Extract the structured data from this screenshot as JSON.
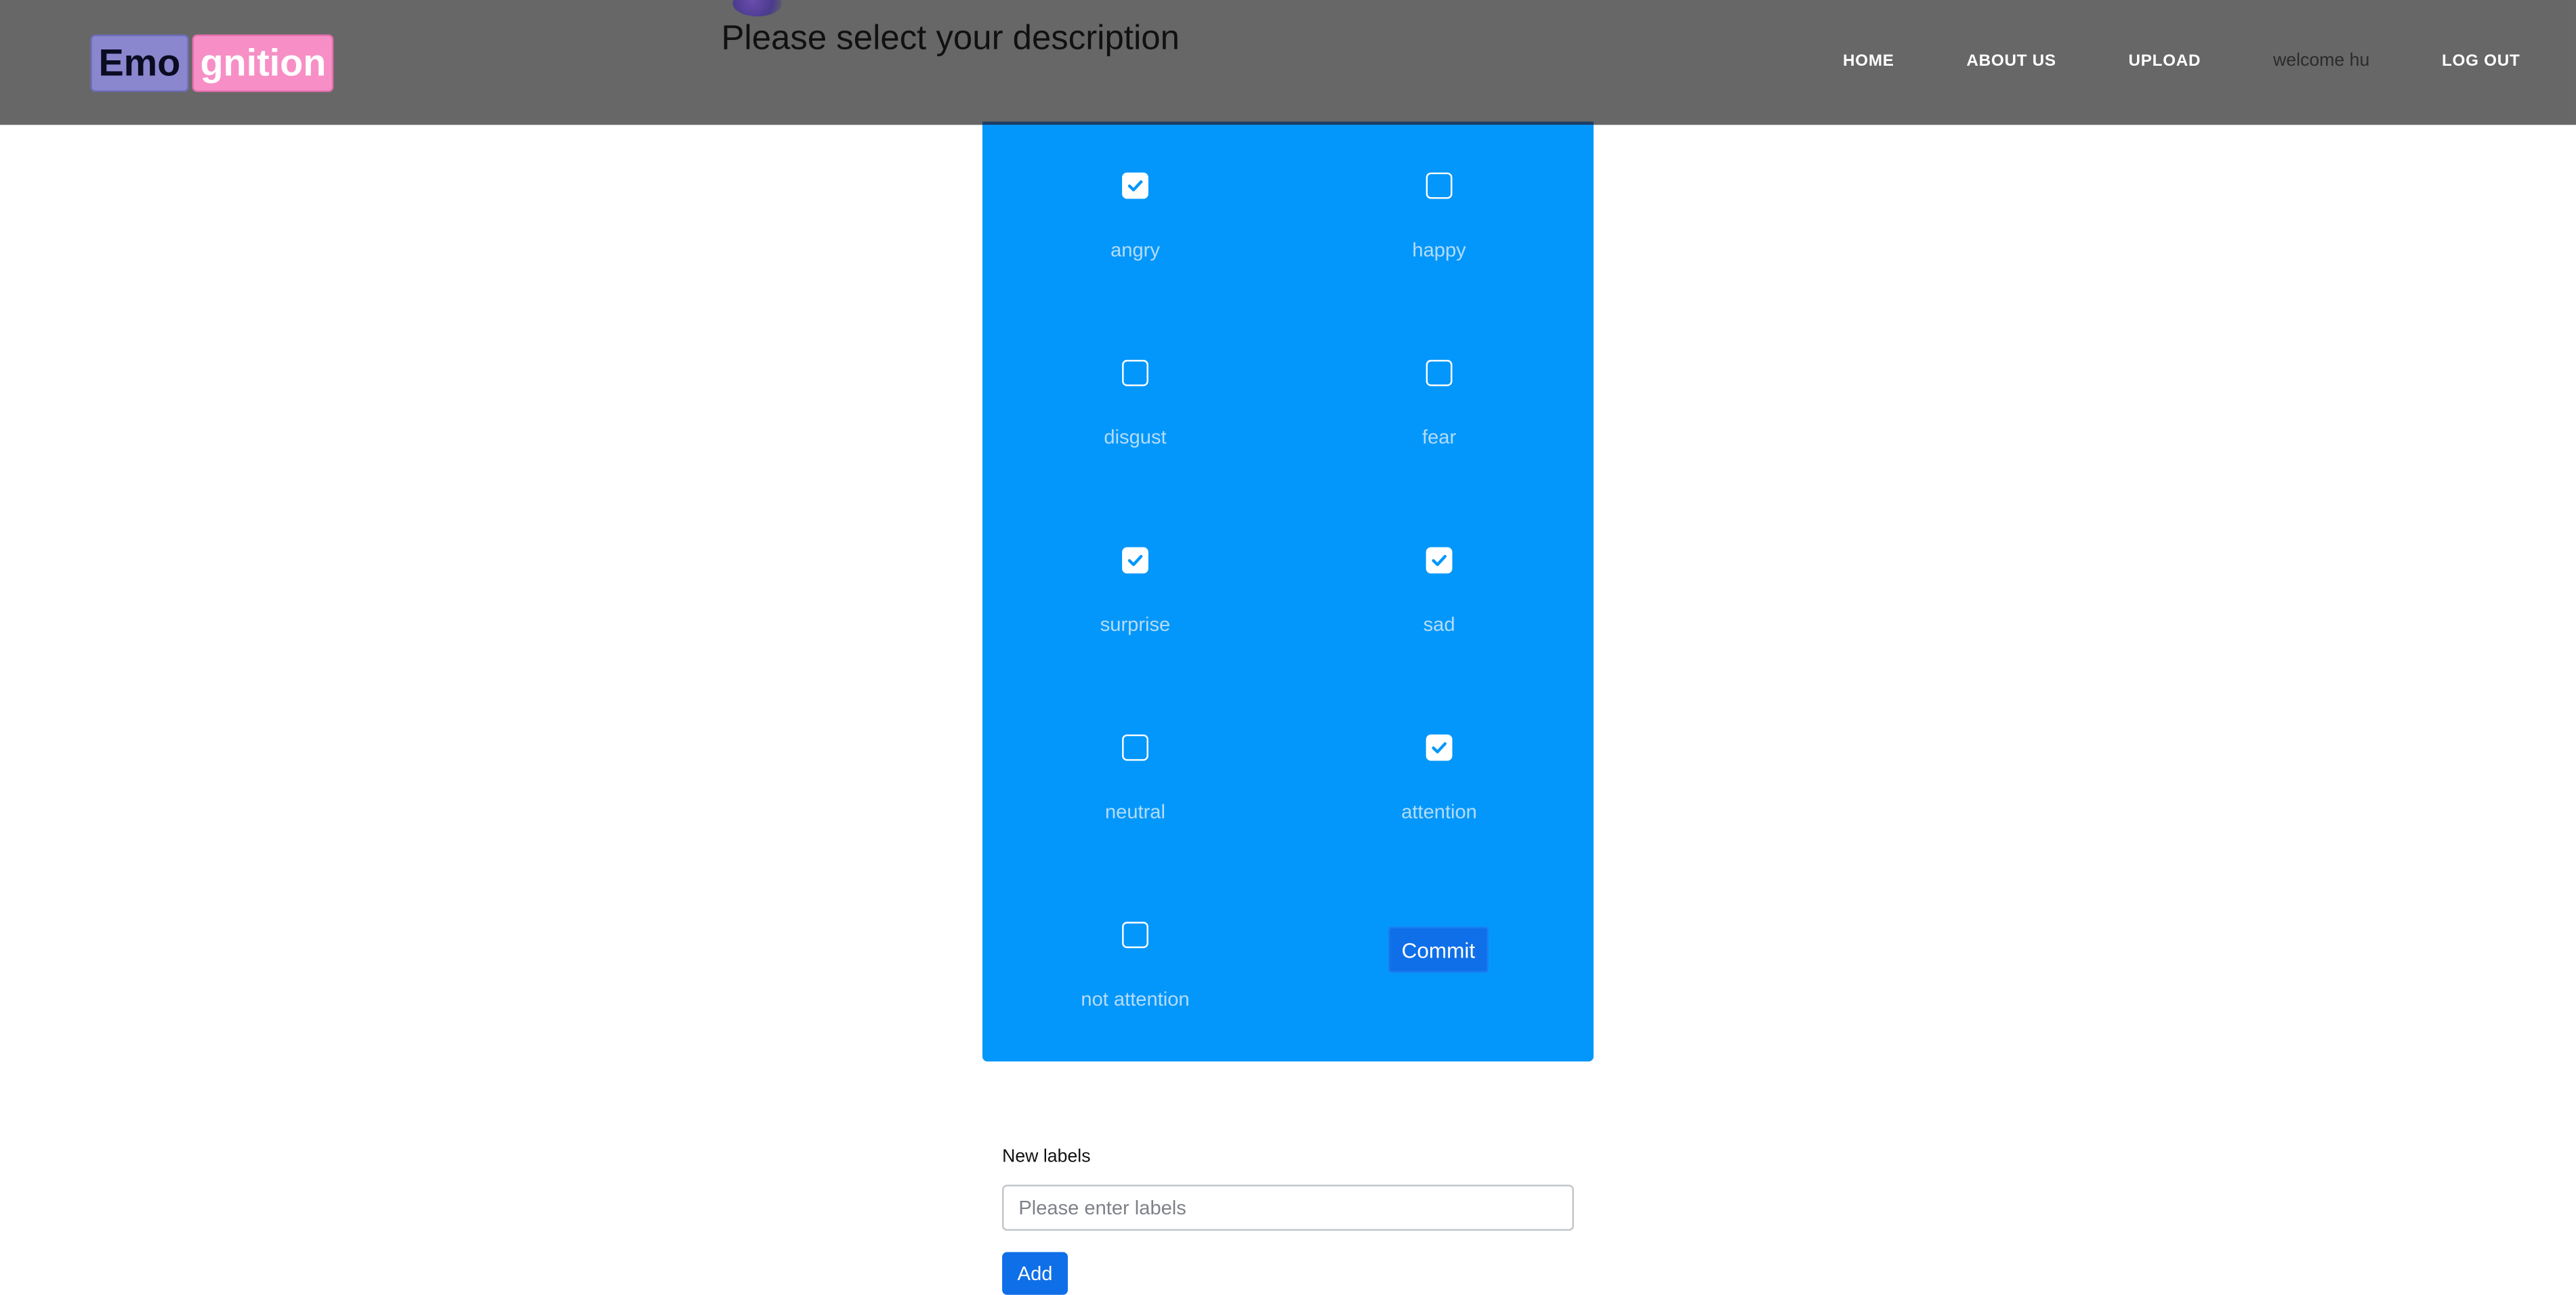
{
  "header": {
    "logo_part1": "Emo",
    "logo_part2": "gnition",
    "page_title": "Please select your description",
    "nav": {
      "home": "HOME",
      "about": "ABOUT US",
      "upload": "UPLOAD",
      "welcome": "welcome hu",
      "logout": "LOG OUT"
    }
  },
  "form": {
    "options": [
      {
        "label": "angry",
        "checked": true
      },
      {
        "label": "happy",
        "checked": false
      },
      {
        "label": "disgust",
        "checked": false
      },
      {
        "label": "fear",
        "checked": false
      },
      {
        "label": "surprise",
        "checked": true
      },
      {
        "label": "sad",
        "checked": true
      },
      {
        "label": "neutral",
        "checked": false
      },
      {
        "label": "attention",
        "checked": true
      },
      {
        "label": "not attention",
        "checked": false
      }
    ],
    "commit_label": "Commit"
  },
  "new_labels": {
    "label": "New labels",
    "placeholder": "Please enter labels",
    "value": "",
    "add_label": "Add"
  },
  "colors": {
    "navbar": "#676767",
    "panel": "#0497fb",
    "button": "#0f6fe8",
    "logo_emo": "#8a87cf",
    "logo_gnition": "#f78fc6"
  },
  "icons": {
    "checkmark": "check-icon"
  }
}
